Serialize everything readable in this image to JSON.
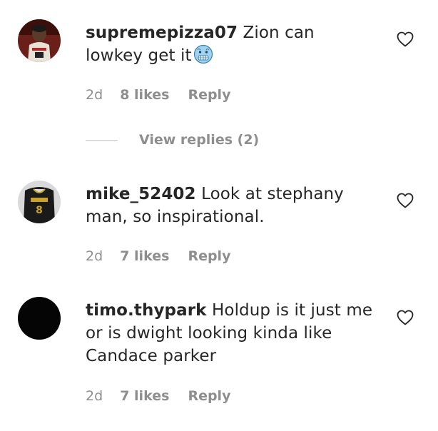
{
  "comments": [
    {
      "username": "supremepizza07",
      "text": "Zion can lowkey get it",
      "emoji": "cold-face-emoji",
      "time": "2d",
      "likes": "8 likes",
      "reply": "Reply"
    },
    {
      "username": "mike_52402",
      "text": "Look at stephany man, so inspirational.",
      "time": "2d",
      "likes": "7 likes",
      "reply": "Reply"
    },
    {
      "username": "timo.thypark",
      "text": "Holdup is it just me or is dwight looking kinda like Candace parker",
      "time": "2d",
      "likes": "7 likes",
      "reply": "Reply"
    }
  ],
  "view_replies": {
    "label": "View replies (2)"
  },
  "colors": {
    "text": "#262626",
    "meta": "#8e8e8e",
    "divider": "#c7c7c7",
    "background": "#ffffff"
  },
  "icons": {
    "like": "heart-outline-icon"
  }
}
